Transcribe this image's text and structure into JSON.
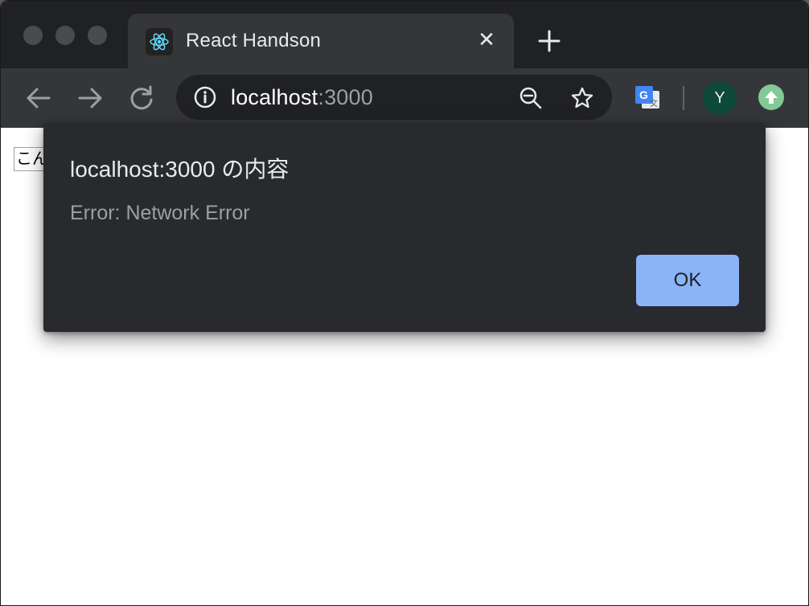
{
  "tab": {
    "title": "React Handson",
    "favicon": "react-logo-icon",
    "close_symbol": "✕"
  },
  "toolbar": {
    "url_host": "localhost",
    "url_port": ":3000"
  },
  "profile": {
    "initial": "Y",
    "color": "#0e4a3a"
  },
  "page": {
    "input_value": "こんに"
  },
  "dialog": {
    "title": "localhost:3000 の内容",
    "message": "Error: Network Error",
    "ok_label": "OK",
    "ok_color": "#8ab4f8"
  }
}
